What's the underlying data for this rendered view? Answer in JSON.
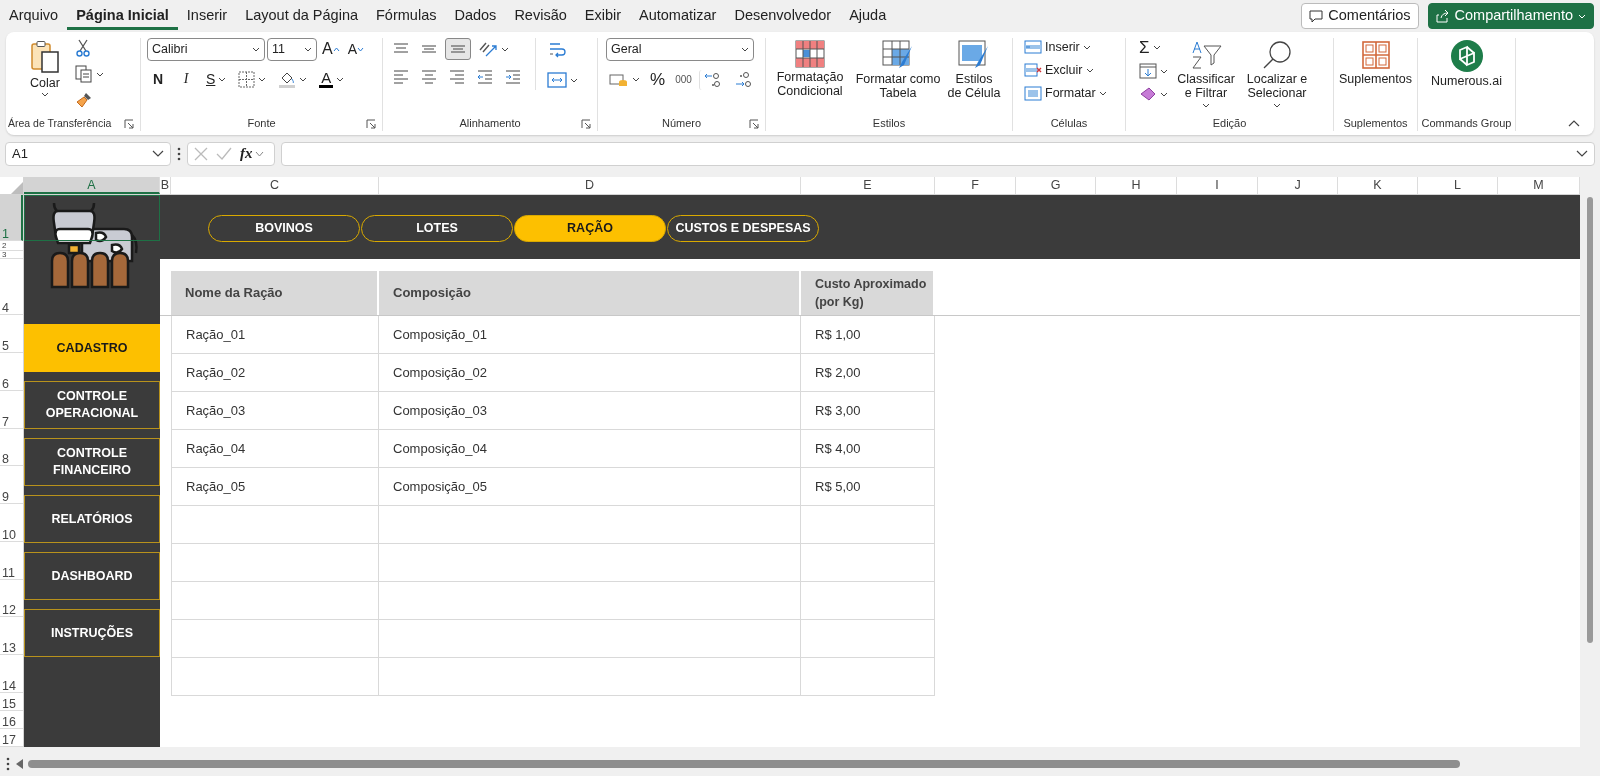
{
  "menu_tabs": [
    {
      "label": "Arquivo",
      "selected": false
    },
    {
      "label": "Página Inicial",
      "selected": true
    },
    {
      "label": "Inserir",
      "selected": false
    },
    {
      "label": "Layout da Página",
      "selected": false
    },
    {
      "label": "Fórmulas",
      "selected": false
    },
    {
      "label": "Dados",
      "selected": false
    },
    {
      "label": "Revisão",
      "selected": false
    },
    {
      "label": "Exibir",
      "selected": false
    },
    {
      "label": "Automatizar",
      "selected": false
    },
    {
      "label": "Desenvolvedor",
      "selected": false
    },
    {
      "label": "Ajuda",
      "selected": false
    }
  ],
  "header_buttons": {
    "comments": "Comentários",
    "share": "Compartilhamento"
  },
  "clipboard": {
    "paste": "Colar",
    "group_label": "Área de Transferência",
    "launcher": true
  },
  "font": {
    "name": "Calibri",
    "size": "11",
    "grow": "A",
    "shrink": "A",
    "bold": "N",
    "italic": "I",
    "underline": "S",
    "font_color_letter": "A",
    "group_label": "Fonte",
    "launcher": true
  },
  "alignment": {
    "group_label": "Alinhamento",
    "launcher": true
  },
  "number": {
    "format": "Geral",
    "percent": "%",
    "thousands": "000",
    "group_label": "Número",
    "launcher": true
  },
  "styles": {
    "conditional": "Formatação Condicional",
    "as_table": "Formatar como Tabela",
    "cell_styles": "Estilos de Célula",
    "group_label": "Estilos"
  },
  "cells": {
    "insert": "Inserir",
    "delete": "Excluir",
    "format": "Formatar",
    "group_label": "Células"
  },
  "editing": {
    "autosum": "Σ",
    "sort": "Classificar e Filtrar",
    "find": "Localizar e Selecionar",
    "group_label": "Edição"
  },
  "addins": {
    "button": "Suplementos",
    "group_label": "Suplementos"
  },
  "commands": {
    "button": "Numerous.ai",
    "group_label": "Commands Group"
  },
  "formula_bar": {
    "name_box": "A1",
    "fx": "fx"
  },
  "columns": [
    {
      "label": "A",
      "selected": true
    },
    {
      "label": "B",
      "selected": false
    },
    {
      "label": "C",
      "selected": false
    },
    {
      "label": "D",
      "selected": false
    },
    {
      "label": "E",
      "selected": false
    },
    {
      "label": "F",
      "selected": false
    },
    {
      "label": "G",
      "selected": false
    },
    {
      "label": "H",
      "selected": false
    },
    {
      "label": "I",
      "selected": false
    },
    {
      "label": "J",
      "selected": false
    },
    {
      "label": "K",
      "selected": false
    },
    {
      "label": "L",
      "selected": false
    },
    {
      "label": "M",
      "selected": false
    }
  ],
  "rows": [
    {
      "label": "1",
      "selected": true
    },
    {
      "label": "2",
      "selected": false
    },
    {
      "label": "3",
      "selected": false
    },
    {
      "label": "4",
      "selected": false
    },
    {
      "label": "5",
      "selected": false
    },
    {
      "label": "6",
      "selected": false
    },
    {
      "label": "7",
      "selected": false
    },
    {
      "label": "8",
      "selected": false
    },
    {
      "label": "9",
      "selected": false
    },
    {
      "label": "10",
      "selected": false
    },
    {
      "label": "11",
      "selected": false
    },
    {
      "label": "12",
      "selected": false
    },
    {
      "label": "13",
      "selected": false
    },
    {
      "label": "14",
      "selected": false
    },
    {
      "label": "15",
      "selected": false
    },
    {
      "label": "16",
      "selected": false
    },
    {
      "label": "17",
      "selected": false
    }
  ],
  "sheet_tabs": [
    {
      "label": "BOVINOS",
      "selected": false
    },
    {
      "label": "LOTES",
      "selected": false
    },
    {
      "label": "RAÇÃO",
      "selected": true
    },
    {
      "label": "CUSTOS E DESPESAS",
      "selected": false
    }
  ],
  "sidebar": [
    {
      "label": "CADASTRO",
      "selected": true
    },
    {
      "label": "CONTROLE OPERACIONAL",
      "selected": false
    },
    {
      "label": "CONTROLE FINANCEIRO",
      "selected": false
    },
    {
      "label": "RELATÓRIOS",
      "selected": false
    },
    {
      "label": "DASHBOARD",
      "selected": false
    },
    {
      "label": "INSTRUÇÕES",
      "selected": false
    }
  ],
  "table": {
    "columns": [
      "Nome da Ração",
      "Composição",
      "Custo Aproximado (por Kg)"
    ],
    "rows": [
      [
        "Ração_01",
        "Composição_01",
        "R$ 1,00"
      ],
      [
        "Ração_02",
        "Composição_02",
        "R$ 2,00"
      ],
      [
        "Ração_03",
        "Composição_03",
        "R$ 3,00"
      ],
      [
        "Ração_04",
        "Composição_04",
        "R$ 4,00"
      ],
      [
        "Ração_05",
        "Composição_05",
        "R$ 5,00"
      ]
    ]
  }
}
